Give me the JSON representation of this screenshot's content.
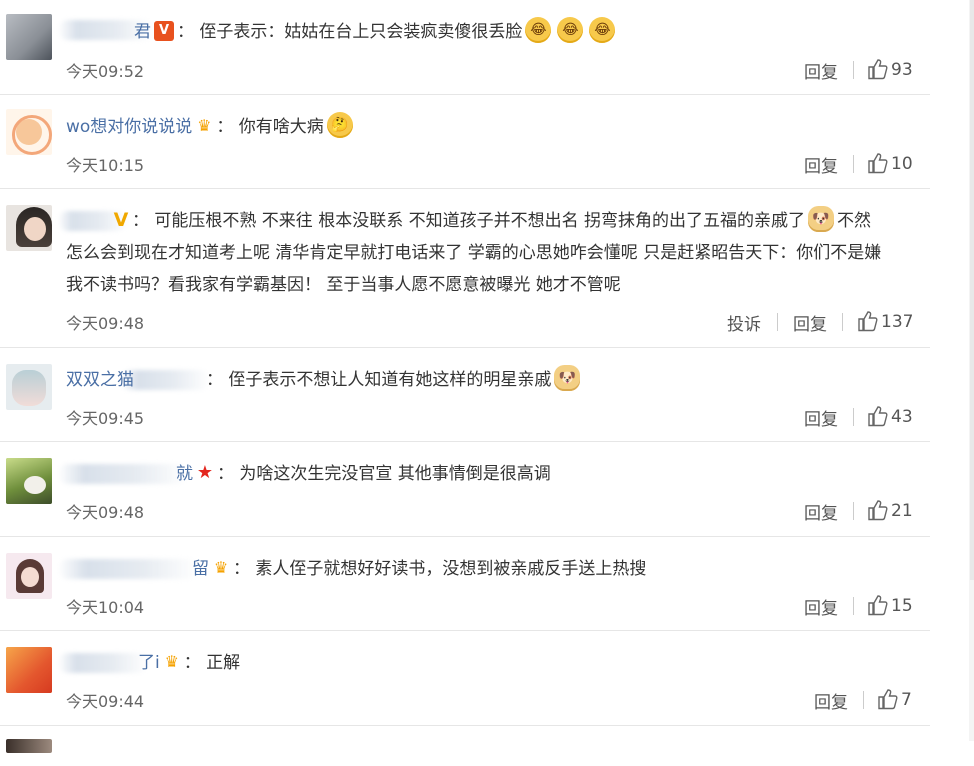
{
  "comments": [
    {
      "username": "",
      "username_visible_suffix": "君",
      "badge": "V",
      "text": "侄子表示：姑姑在台上只会装疯卖傻很丢脸",
      "emoji_count": 3,
      "time": "今天09:52",
      "reply_label": "回复",
      "likes": "93"
    },
    {
      "username": "wo想对你说说说",
      "badge": "crown",
      "text": "你有啥大病",
      "time": "今天10:15",
      "reply_label": "回复",
      "likes": "10"
    },
    {
      "username": "",
      "badge": "V",
      "text_line1": "可能压根不熟 不来往 根本没联系 不知道孩子并不想出名 拐弯抹角的出了五福的亲戚了",
      "text_line1_after": "不然",
      "text_line2": "怎么会到现在才知道考上呢 清华肯定早就打电话来了 学霸的心思她咋会懂呢 只是赶紧昭告天下：你们不是嫌",
      "text_line3": "我不读书吗？看我家有学霸基因！ 至于当事人愿不愿意被曝光 她才不管呢",
      "time": "今天09:48",
      "report_label": "投诉",
      "reply_label": "回复",
      "likes": "137"
    },
    {
      "username": "双双之猫",
      "badge": "",
      "text": "侄子表示不想让人知道有她这样的明星亲戚",
      "time": "今天09:45",
      "reply_label": "回复",
      "likes": "43"
    },
    {
      "username": "",
      "username_visible_suffix": "就",
      "badge": "star",
      "text": "为啥这次生完没官宣 其他事情倒是很高调",
      "time": "今天09:48",
      "reply_label": "回复",
      "likes": "21"
    },
    {
      "username": "",
      "username_visible_suffix": "留",
      "badge": "crown",
      "text": "素人侄子就想好好读书，没想到被亲戚反手送上热搜",
      "time": "今天10:04",
      "reply_label": "回复",
      "likes": "15"
    },
    {
      "username": "",
      "username_visible_suffix": "了i",
      "badge": "crown",
      "text": "正解",
      "time": "今天09:44",
      "reply_label": "回复",
      "likes": "7"
    }
  ],
  "colors": {
    "accent_link": "#4a6fa5",
    "divider": "#e6e6e6",
    "badge_red": "#e8511e",
    "badge_gold": "#f0a800"
  },
  "icons": {
    "like": "thumbs-up-icon",
    "laugh": "laughing-emoji-icon",
    "doge": "doge-emoji-icon",
    "think": "thinking-emoji-icon"
  },
  "punct": {
    "colon": "："
  },
  "glyphs": {
    "v": "V",
    "crown": "♛",
    "star": "★",
    "laugh": "😂",
    "think": "🤔",
    "doge": "🐶"
  }
}
